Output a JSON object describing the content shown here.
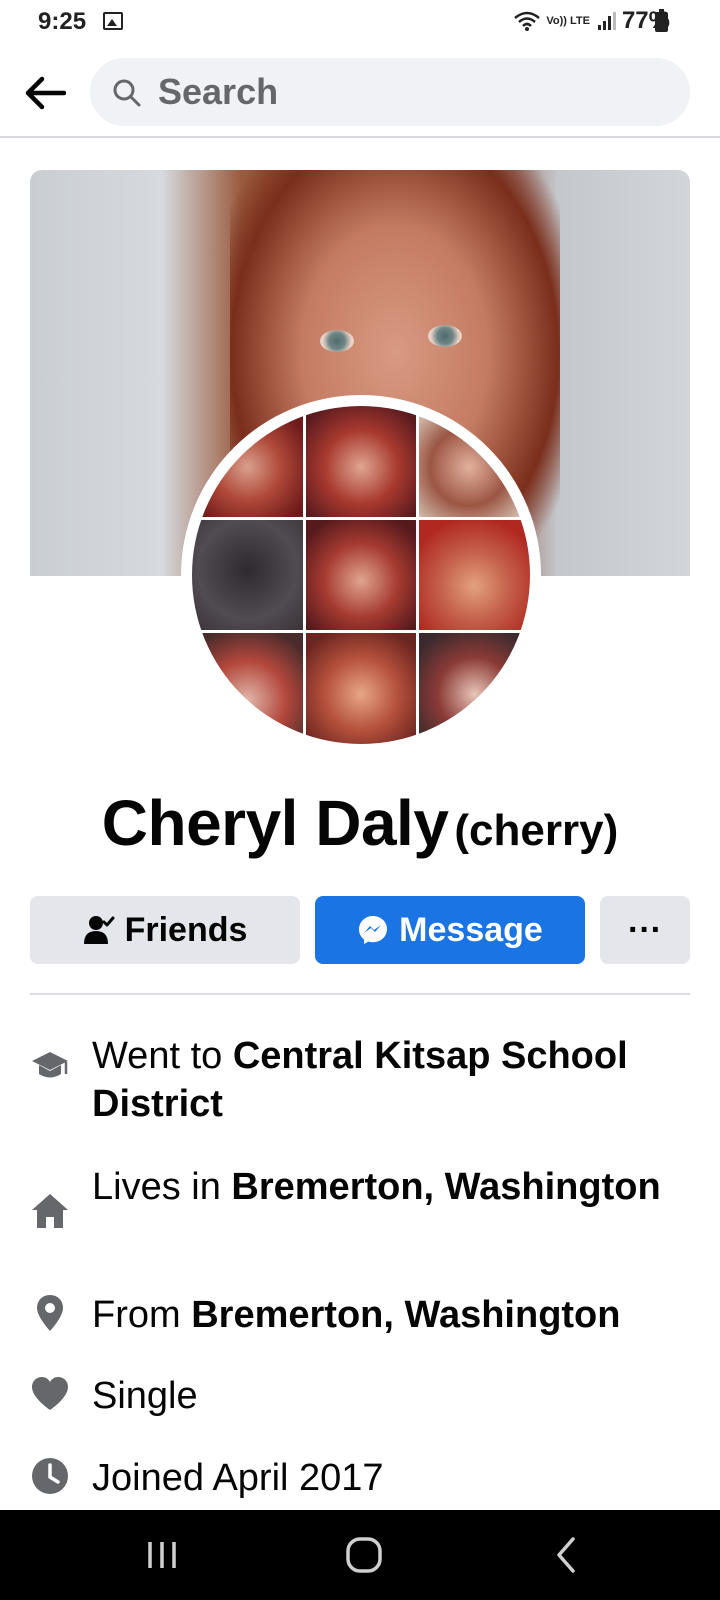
{
  "status_bar": {
    "time": "9:25",
    "network_label": "Vo)) LTE",
    "battery_percent": "77%"
  },
  "search": {
    "placeholder": "Search"
  },
  "profile": {
    "name": "Cheryl Daly",
    "alternate_name": "(cherry)"
  },
  "actions": {
    "friends_label": "Friends",
    "message_label": "Message",
    "more_label": "···"
  },
  "intro": [
    {
      "icon": "graduation-cap-icon",
      "prefix": "Went to ",
      "bold": "Central Kitsap School District"
    },
    {
      "icon": "home-icon",
      "prefix": "Lives in ",
      "bold": "Bremerton, Washington"
    },
    {
      "icon": "location-pin-icon",
      "prefix": "From ",
      "bold": "Bremerton, Washington"
    },
    {
      "icon": "heart-icon",
      "prefix": "Single",
      "bold": ""
    },
    {
      "icon": "clock-icon",
      "prefix": "Joined April 2017",
      "bold": ""
    }
  ],
  "colors": {
    "accent": "#1b74e4",
    "button_gray": "#e4e6eb",
    "search_bg": "#f0f2f5",
    "icon_gray": "#65676b"
  }
}
